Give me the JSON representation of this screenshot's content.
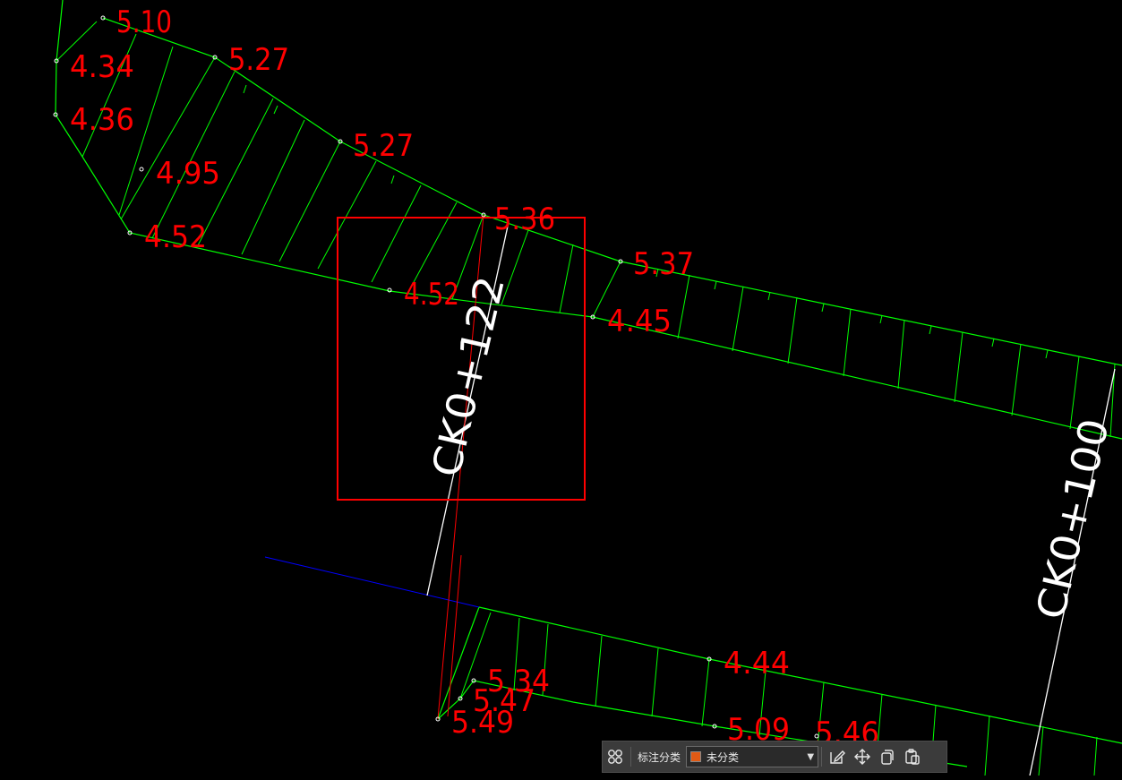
{
  "colors": {
    "background": "#000000",
    "contour": "#00ff00",
    "elevation_label": "#ff0000",
    "chainage_label": "#ffffff",
    "highlight_box": "#ff0000",
    "blue_line": "#0000ff",
    "point_marker": "#ffffff"
  },
  "elevation_labels": [
    "5.10",
    "4.34",
    "5.27",
    "4.36",
    "5.27",
    "4.95",
    "5.36",
    "4.52",
    "5.37",
    "4.52",
    "4.45",
    "4.44",
    "5.34",
    "5.47",
    "5.49",
    "5.09",
    "5.46"
  ],
  "chainage_labels": [
    "CK0+122",
    "CK0+100"
  ],
  "toolbar": {
    "group_icon": "group-icon",
    "label": "标注分类",
    "category_value": "未分类",
    "category_color": "#e05a14",
    "edit_icon": "edit-icon",
    "move_icon": "move-icon",
    "copy_icon": "copy-icon",
    "paste_icon": "paste-icon"
  }
}
